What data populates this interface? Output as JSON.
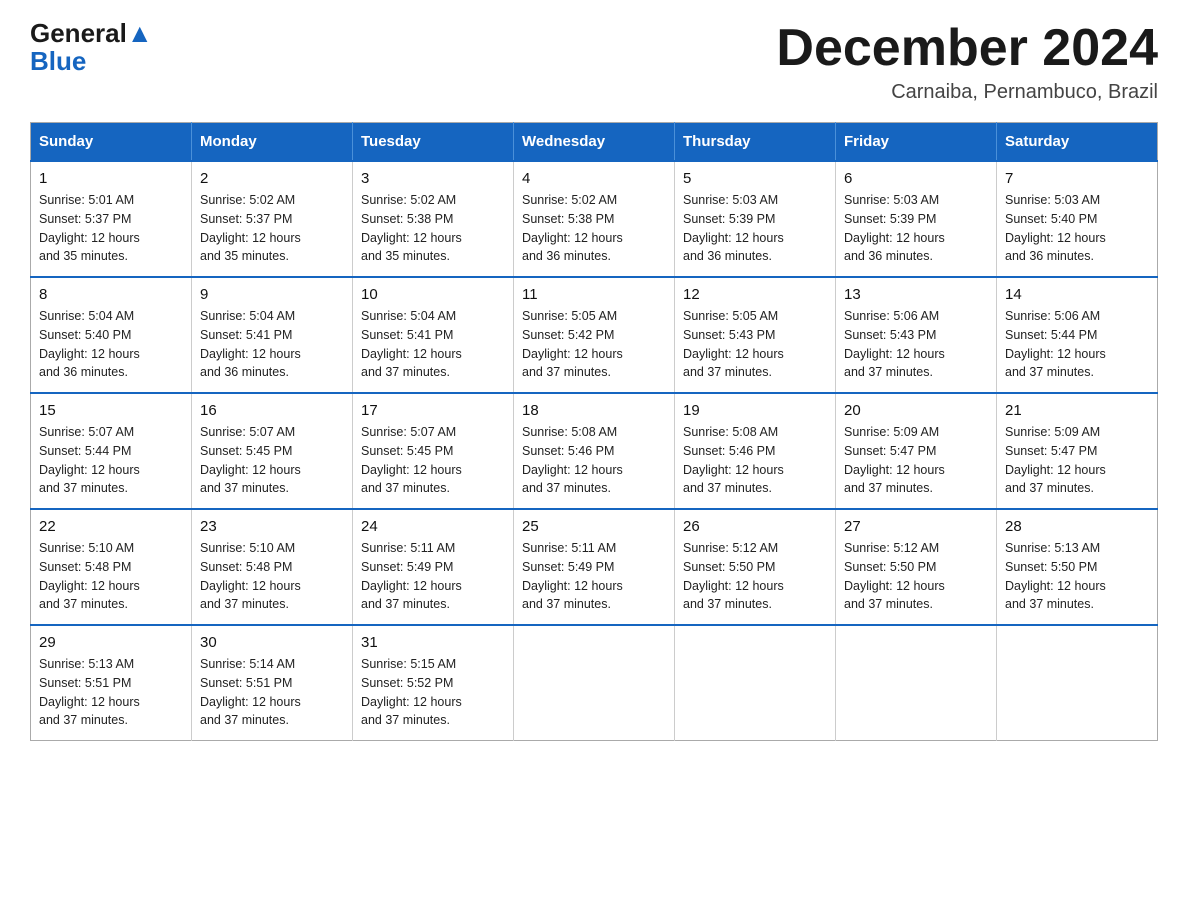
{
  "header": {
    "logo_general": "General",
    "logo_blue": "Blue",
    "month_year": "December 2024",
    "location": "Carnaiba, Pernambuco, Brazil"
  },
  "weekdays": [
    "Sunday",
    "Monday",
    "Tuesday",
    "Wednesday",
    "Thursday",
    "Friday",
    "Saturday"
  ],
  "weeks": [
    [
      {
        "day": "1",
        "sunrise": "5:01 AM",
        "sunset": "5:37 PM",
        "daylight": "12 hours and 35 minutes."
      },
      {
        "day": "2",
        "sunrise": "5:02 AM",
        "sunset": "5:37 PM",
        "daylight": "12 hours and 35 minutes."
      },
      {
        "day": "3",
        "sunrise": "5:02 AM",
        "sunset": "5:38 PM",
        "daylight": "12 hours and 35 minutes."
      },
      {
        "day": "4",
        "sunrise": "5:02 AM",
        "sunset": "5:38 PM",
        "daylight": "12 hours and 36 minutes."
      },
      {
        "day": "5",
        "sunrise": "5:03 AM",
        "sunset": "5:39 PM",
        "daylight": "12 hours and 36 minutes."
      },
      {
        "day": "6",
        "sunrise": "5:03 AM",
        "sunset": "5:39 PM",
        "daylight": "12 hours and 36 minutes."
      },
      {
        "day": "7",
        "sunrise": "5:03 AM",
        "sunset": "5:40 PM",
        "daylight": "12 hours and 36 minutes."
      }
    ],
    [
      {
        "day": "8",
        "sunrise": "5:04 AM",
        "sunset": "5:40 PM",
        "daylight": "12 hours and 36 minutes."
      },
      {
        "day": "9",
        "sunrise": "5:04 AM",
        "sunset": "5:41 PM",
        "daylight": "12 hours and 36 minutes."
      },
      {
        "day": "10",
        "sunrise": "5:04 AM",
        "sunset": "5:41 PM",
        "daylight": "12 hours and 37 minutes."
      },
      {
        "day": "11",
        "sunrise": "5:05 AM",
        "sunset": "5:42 PM",
        "daylight": "12 hours and 37 minutes."
      },
      {
        "day": "12",
        "sunrise": "5:05 AM",
        "sunset": "5:43 PM",
        "daylight": "12 hours and 37 minutes."
      },
      {
        "day": "13",
        "sunrise": "5:06 AM",
        "sunset": "5:43 PM",
        "daylight": "12 hours and 37 minutes."
      },
      {
        "day": "14",
        "sunrise": "5:06 AM",
        "sunset": "5:44 PM",
        "daylight": "12 hours and 37 minutes."
      }
    ],
    [
      {
        "day": "15",
        "sunrise": "5:07 AM",
        "sunset": "5:44 PM",
        "daylight": "12 hours and 37 minutes."
      },
      {
        "day": "16",
        "sunrise": "5:07 AM",
        "sunset": "5:45 PM",
        "daylight": "12 hours and 37 minutes."
      },
      {
        "day": "17",
        "sunrise": "5:07 AM",
        "sunset": "5:45 PM",
        "daylight": "12 hours and 37 minutes."
      },
      {
        "day": "18",
        "sunrise": "5:08 AM",
        "sunset": "5:46 PM",
        "daylight": "12 hours and 37 minutes."
      },
      {
        "day": "19",
        "sunrise": "5:08 AM",
        "sunset": "5:46 PM",
        "daylight": "12 hours and 37 minutes."
      },
      {
        "day": "20",
        "sunrise": "5:09 AM",
        "sunset": "5:47 PM",
        "daylight": "12 hours and 37 minutes."
      },
      {
        "day": "21",
        "sunrise": "5:09 AM",
        "sunset": "5:47 PM",
        "daylight": "12 hours and 37 minutes."
      }
    ],
    [
      {
        "day": "22",
        "sunrise": "5:10 AM",
        "sunset": "5:48 PM",
        "daylight": "12 hours and 37 minutes."
      },
      {
        "day": "23",
        "sunrise": "5:10 AM",
        "sunset": "5:48 PM",
        "daylight": "12 hours and 37 minutes."
      },
      {
        "day": "24",
        "sunrise": "5:11 AM",
        "sunset": "5:49 PM",
        "daylight": "12 hours and 37 minutes."
      },
      {
        "day": "25",
        "sunrise": "5:11 AM",
        "sunset": "5:49 PM",
        "daylight": "12 hours and 37 minutes."
      },
      {
        "day": "26",
        "sunrise": "5:12 AM",
        "sunset": "5:50 PM",
        "daylight": "12 hours and 37 minutes."
      },
      {
        "day": "27",
        "sunrise": "5:12 AM",
        "sunset": "5:50 PM",
        "daylight": "12 hours and 37 minutes."
      },
      {
        "day": "28",
        "sunrise": "5:13 AM",
        "sunset": "5:50 PM",
        "daylight": "12 hours and 37 minutes."
      }
    ],
    [
      {
        "day": "29",
        "sunrise": "5:13 AM",
        "sunset": "5:51 PM",
        "daylight": "12 hours and 37 minutes."
      },
      {
        "day": "30",
        "sunrise": "5:14 AM",
        "sunset": "5:51 PM",
        "daylight": "12 hours and 37 minutes."
      },
      {
        "day": "31",
        "sunrise": "5:15 AM",
        "sunset": "5:52 PM",
        "daylight": "12 hours and 37 minutes."
      },
      null,
      null,
      null,
      null
    ]
  ],
  "labels": {
    "sunrise": "Sunrise:",
    "sunset": "Sunset:",
    "daylight": "Daylight:"
  }
}
